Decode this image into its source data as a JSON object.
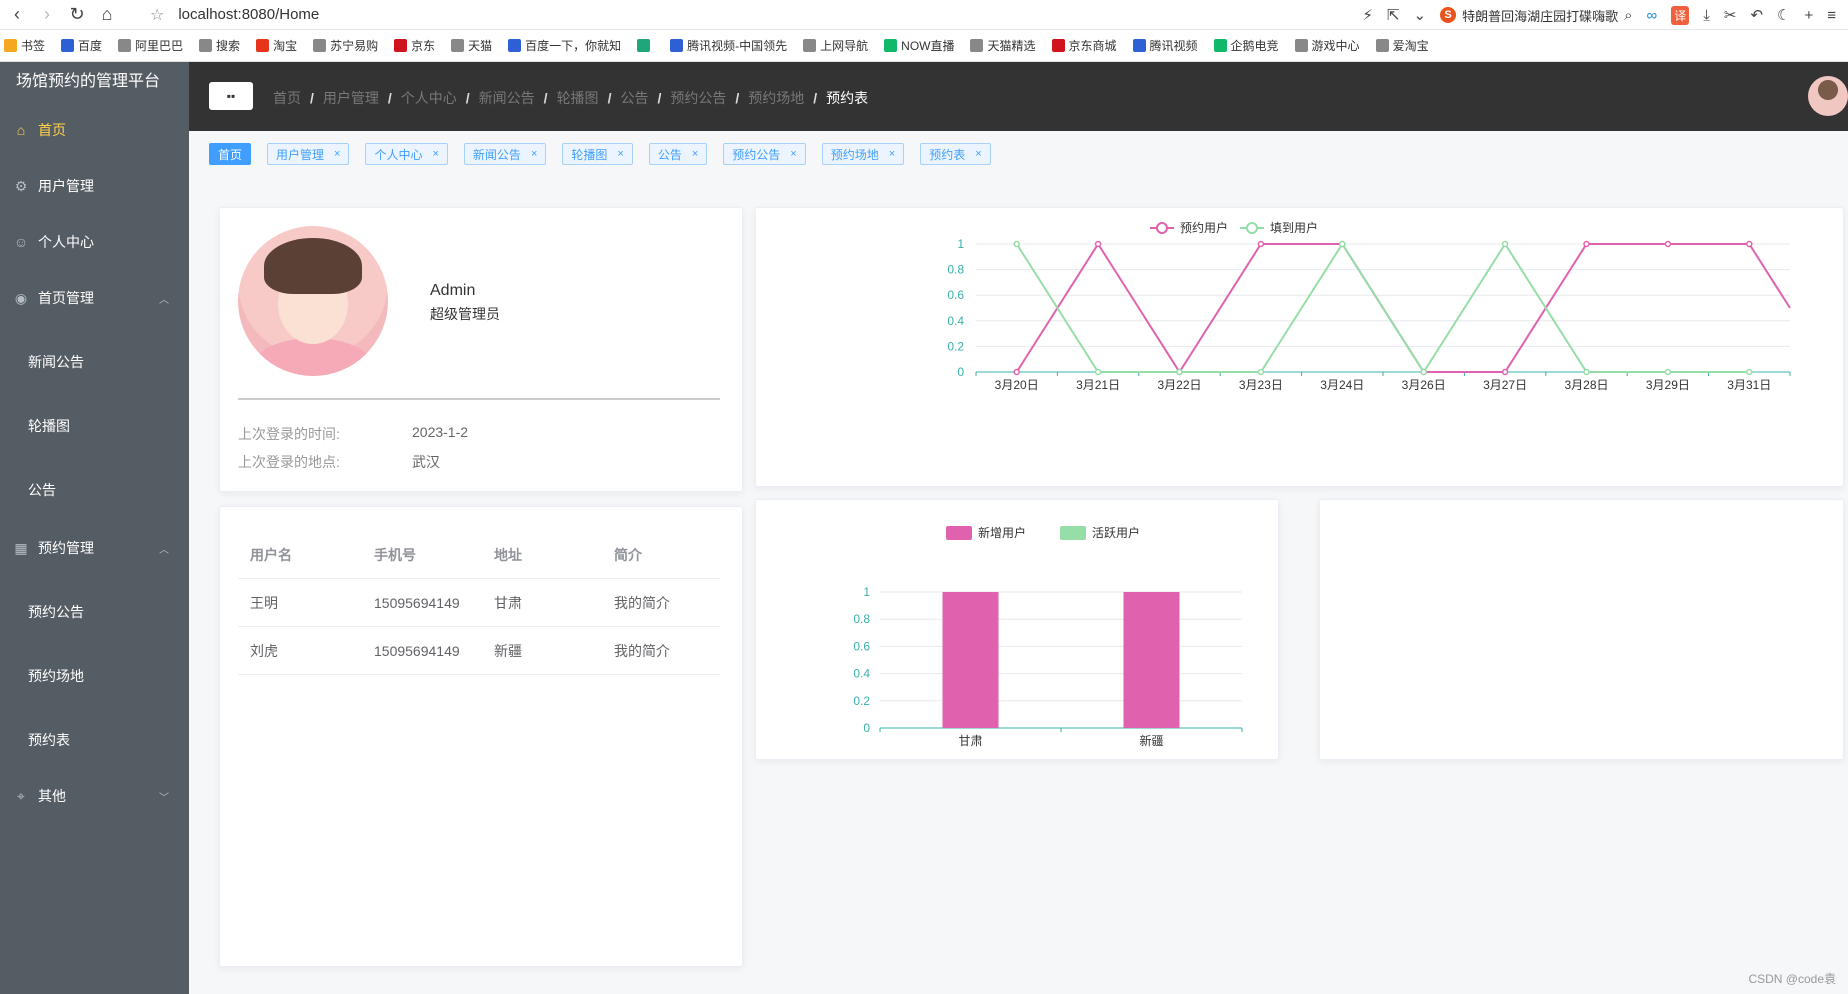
{
  "browser": {
    "url": "localhost:8080/Home",
    "search_text": "特朗普回海湖庄园打碟嗨歌",
    "translate_label": "译",
    "bookmarks": [
      {
        "label": "书签",
        "color": "#f5a623"
      },
      {
        "label": "百度",
        "color": "#2f5fd4"
      },
      {
        "label": "阿里巴巴",
        "color": "#888"
      },
      {
        "label": "搜索",
        "color": "#888"
      },
      {
        "label": "淘宝",
        "color": "#e8341a"
      },
      {
        "label": "苏宁易购",
        "color": "#888"
      },
      {
        "label": "京东",
        "color": "#d0141e"
      },
      {
        "label": "天猫",
        "color": "#888"
      },
      {
        "label": "百度一下，你就知",
        "color": "#2f5fd4"
      },
      {
        "label": "",
        "color": "#1fa67a"
      },
      {
        "label": "腾讯视频-中国领先",
        "color": "#2f5fd4"
      },
      {
        "label": "上网导航",
        "color": "#888"
      },
      {
        "label": "NOW直播",
        "color": "#12b76a"
      },
      {
        "label": "天猫精选",
        "color": "#888"
      },
      {
        "label": "京东商城",
        "color": "#d0141e"
      },
      {
        "label": "腾讯视频",
        "color": "#2f5fd4"
      },
      {
        "label": "企鹅电竞",
        "color": "#12b76a"
      },
      {
        "label": "游戏中心",
        "color": "#888"
      },
      {
        "label": "爱淘宝",
        "color": "#888"
      }
    ]
  },
  "sidebar": {
    "brand": "场馆预约的管理平台",
    "items": [
      {
        "label": "首页",
        "icon": "home-icon"
      },
      {
        "label": "用户管理",
        "icon": "gear-icon"
      },
      {
        "label": "个人中心",
        "icon": "user-icon"
      },
      {
        "label": "首页管理",
        "icon": "play-circle-icon"
      },
      {
        "label": "新闻公告"
      },
      {
        "label": "轮播图"
      },
      {
        "label": "公告"
      },
      {
        "label": "预约管理",
        "icon": "calendar-icon"
      },
      {
        "label": "预约公告"
      },
      {
        "label": "预约场地"
      },
      {
        "label": "预约表"
      },
      {
        "label": "其他",
        "icon": "location-icon"
      }
    ]
  },
  "header": {
    "breadcrumb": [
      "首页",
      "用户管理",
      "个人中心",
      "新闻公告",
      "轮播图",
      "公告",
      "预约公告",
      "预约场地",
      "预约表"
    ]
  },
  "tags": [
    "首页",
    "用户管理",
    "个人中心",
    "新闻公告",
    "轮播图",
    "公告",
    "预约公告",
    "预约场地",
    "预约表"
  ],
  "profile": {
    "name": "Admin",
    "role": "超级管理员",
    "last_login_time_label": "上次登录的时间:",
    "last_login_time": "2023-1-2",
    "last_login_place_label": "上次登录的地点:",
    "last_login_place": "武汉"
  },
  "user_table": {
    "headers": [
      "用户名",
      "手机号",
      "地址",
      "简介"
    ],
    "rows": [
      [
        "王明",
        "15095694149",
        "甘肃",
        "我的简介"
      ],
      [
        "刘虎",
        "15095694149",
        "新疆",
        "我的简介"
      ]
    ]
  },
  "footer_watermark": "CSDN @code袁",
  "chart_data": [
    {
      "type": "line",
      "x": [
        "3月20日",
        "3月21日",
        "3月22日",
        "3月23日",
        "3月24日",
        "3月26日",
        "3月27日",
        "3月28日",
        "3月29日",
        "3月31日"
      ],
      "series": [
        {
          "name": "预约用户",
          "values": [
            0,
            1,
            0,
            1,
            1,
            0,
            0,
            1,
            1,
            1
          ],
          "color": "#e062ae"
        },
        {
          "name": "填到用户",
          "values": [
            1,
            0,
            0,
            0,
            1,
            0,
            1,
            0,
            0,
            0
          ],
          "color": "#96dea8"
        }
      ],
      "ylim": [
        0,
        1
      ],
      "y_ticks": [
        "0",
        "0.2",
        "0.4",
        "0.6",
        "0.8",
        "1"
      ],
      "grid": true,
      "legend": "top-center"
    },
    {
      "type": "bar",
      "categories": [
        "甘肃",
        "新疆"
      ],
      "series": [
        {
          "name": "新增用户",
          "values": [
            1,
            1
          ],
          "color": "#e062ae"
        },
        {
          "name": "活跃用户",
          "values": [
            0,
            0
          ],
          "color": "#96dea8"
        }
      ],
      "ylim": [
        0,
        1
      ],
      "y_ticks": [
        "0",
        "0.2",
        "0.4",
        "0.6",
        "0.8",
        "1"
      ],
      "grid": true,
      "legend": "top-center"
    }
  ]
}
